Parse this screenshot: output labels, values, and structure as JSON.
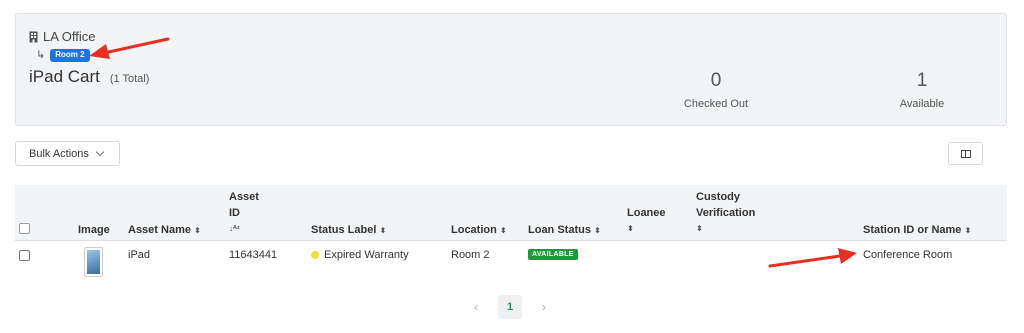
{
  "location": {
    "name": "LA Office",
    "sublocation_badge": "Room 2",
    "sub_arrow": "↳"
  },
  "page": {
    "title": "iPad Cart",
    "total": "(1 Total)"
  },
  "stats": {
    "checked_out": {
      "value": "0",
      "label": "Checked Out"
    },
    "available": {
      "value": "1",
      "label": "Available"
    }
  },
  "toolbar": {
    "bulk_actions": "Bulk Actions"
  },
  "table": {
    "columns": {
      "image": "Image",
      "asset_name": "Asset Name",
      "asset_id_line1": "Asset",
      "asset_id_line2": "ID",
      "status_label": "Status Label",
      "location": "Location",
      "loan_status": "Loan Status",
      "loanee": "Loanee",
      "custody_line1": "Custody",
      "custody_line2": "Verification",
      "station": "Station ID or Name"
    },
    "sort_glyph": "⬍",
    "sort_az_glyph": "↓ᴬᶻ",
    "rows": [
      {
        "asset_name": "iPad",
        "asset_id": "11643441",
        "status_label": "Expired Warranty",
        "location": "Room 2",
        "loan_status": "AVAILABLE",
        "loanee": "",
        "custody_verification": "",
        "station": "Conference Room"
      }
    ]
  },
  "pagination": {
    "prev": "‹",
    "current": "1",
    "next": "›"
  },
  "colors": {
    "badge_blue": "#1a73e8",
    "available_green": "#1a9c3b",
    "status_yellow": "#f2dd36",
    "annotation_red": "#e53023"
  }
}
